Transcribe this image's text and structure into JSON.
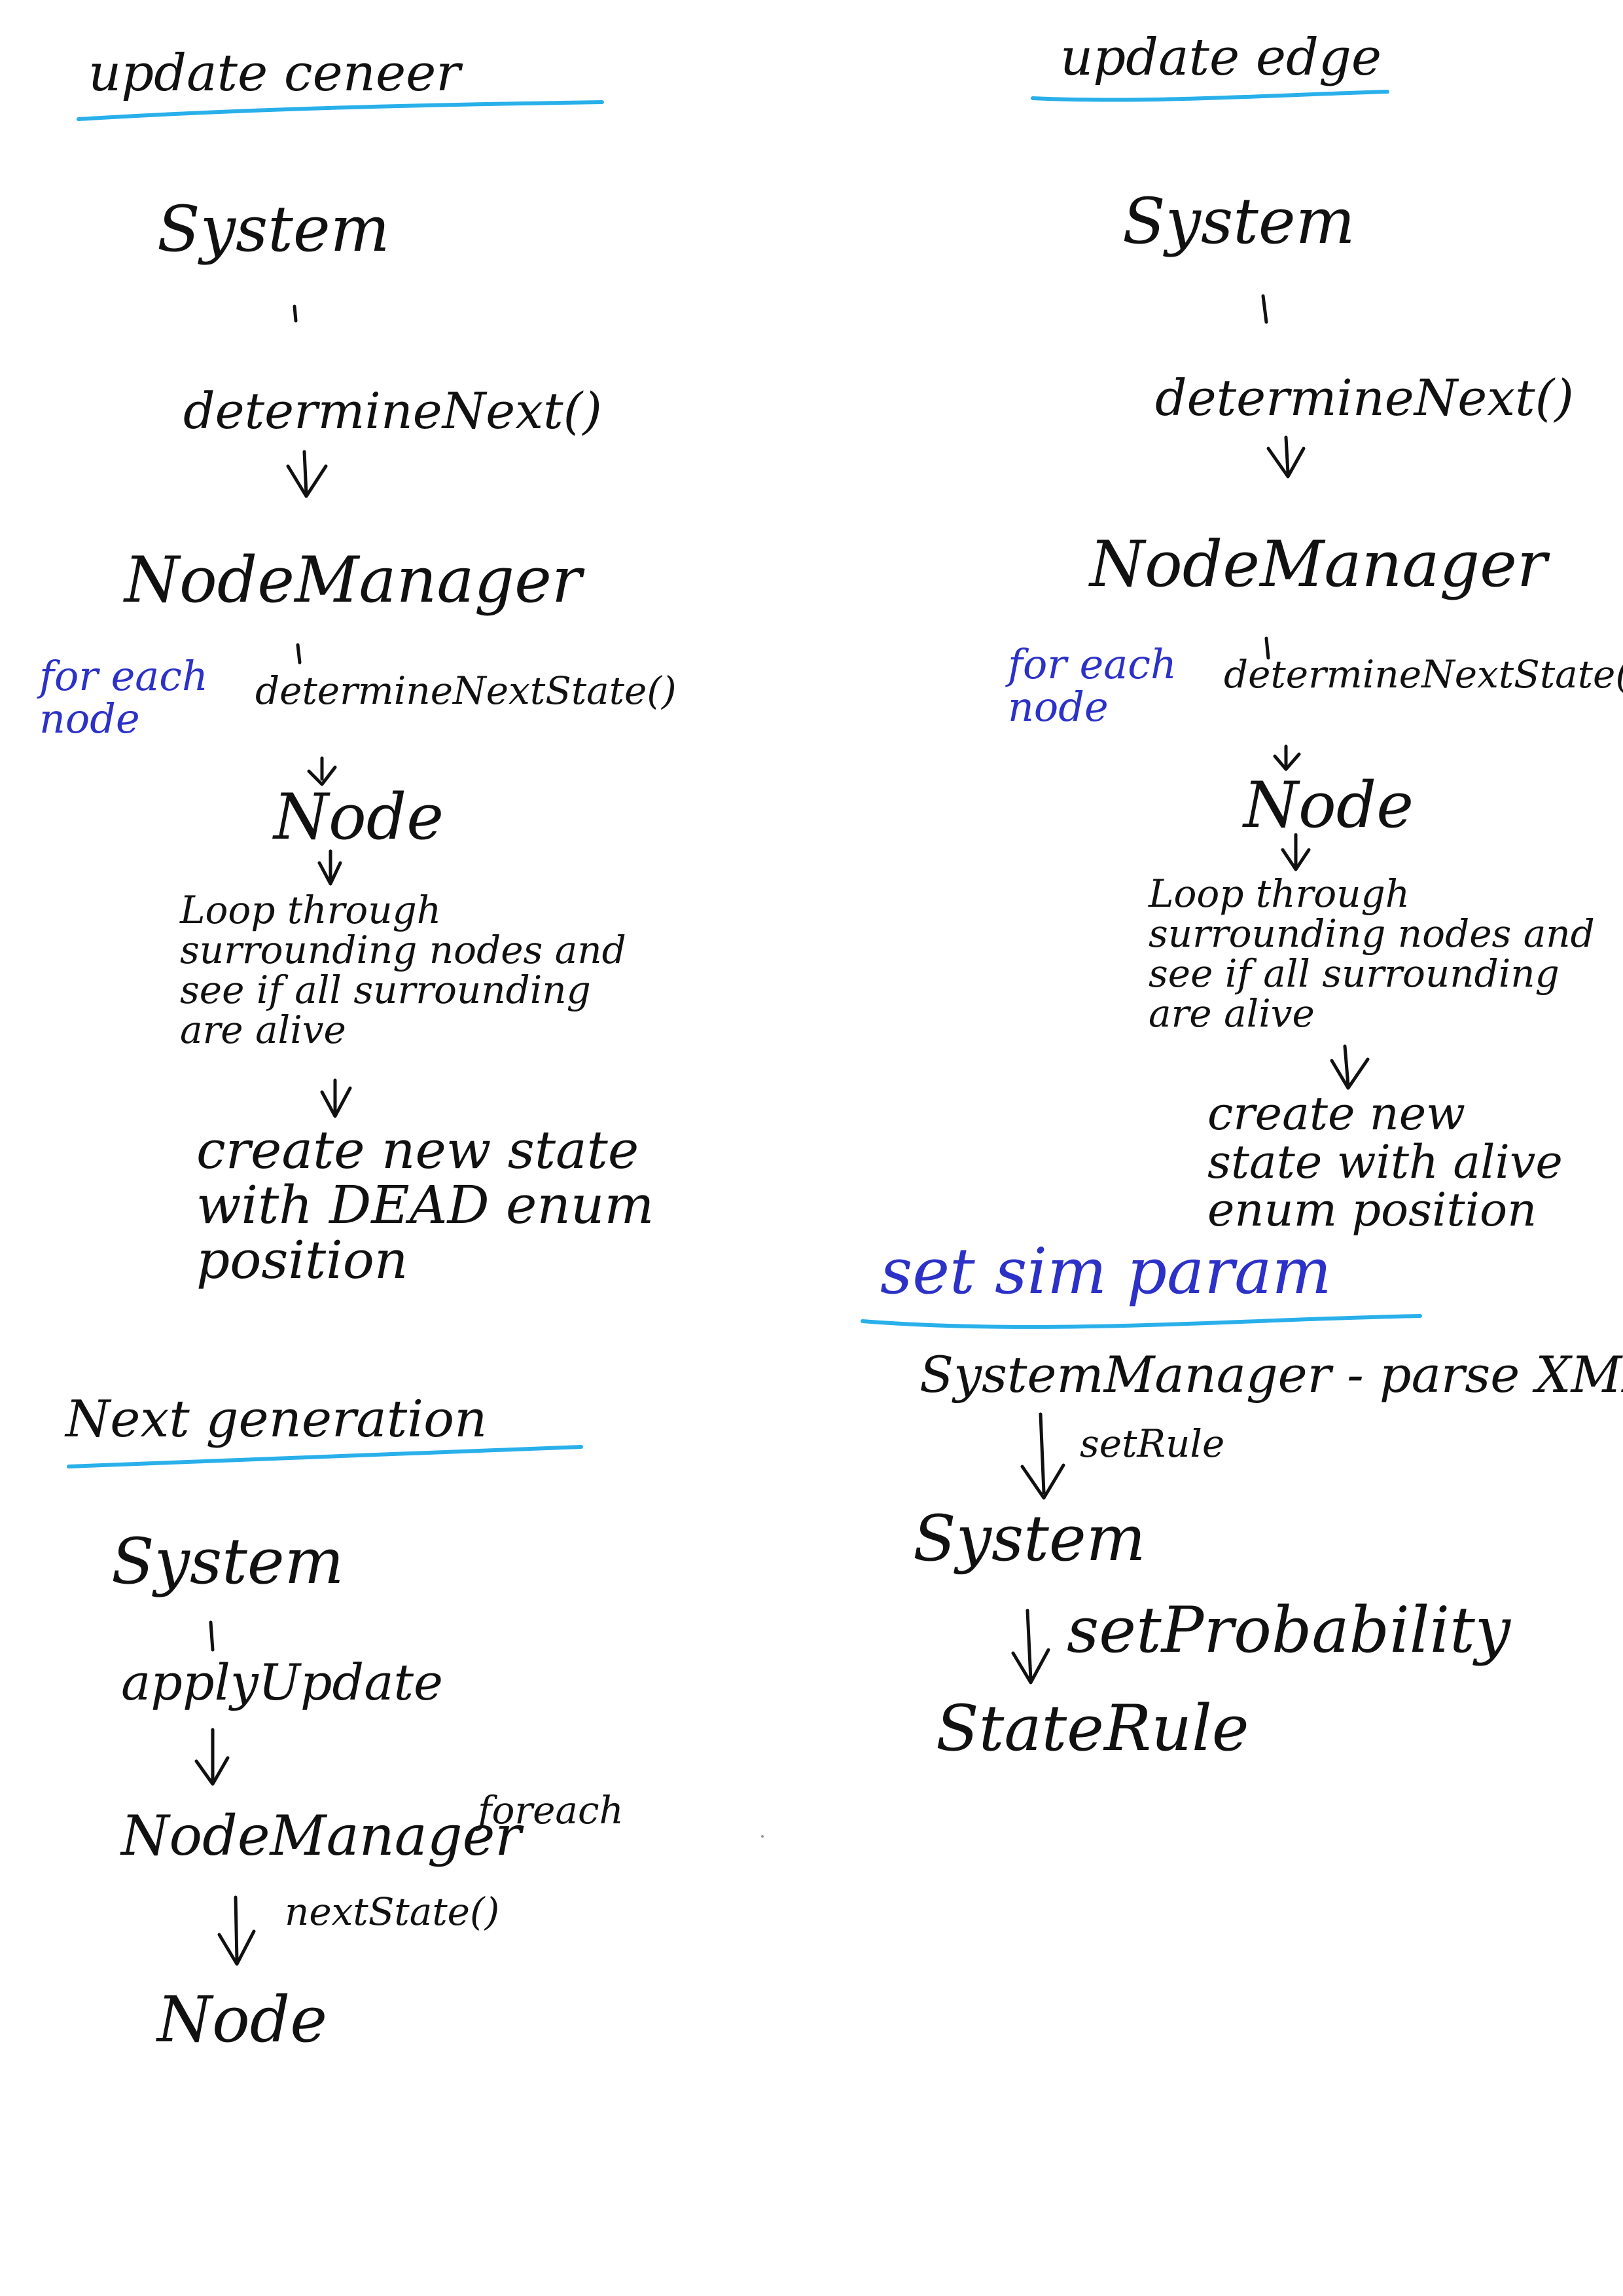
{
  "colors": {
    "ink": "#111111",
    "annotation": "#2c31c7",
    "underline": "#29b0ea"
  },
  "update_center": {
    "title": "update ceneer",
    "system": "System",
    "method_1": "determineNext()",
    "node_manager": "NodeManager",
    "loop_note": "for each node",
    "method_2": "determineNextState()",
    "node": "Node",
    "step_1": "Loop through surrounding nodes and see if all surrounding are alive",
    "step_2": "create new state with DEAD enum position"
  },
  "update_edge": {
    "title": "update edge",
    "system": "System",
    "method_1": "determineNext()",
    "node_manager": "NodeManager",
    "loop_note": "for each node",
    "method_2": "determineNextState()",
    "node": "Node",
    "step_1": "Loop through surrounding nodes and see if all surrounding are alive",
    "step_2": "create new state with alive enum position"
  },
  "next_generation": {
    "title": "Next generation",
    "system": "System",
    "method_1": "applyUpdate",
    "node_manager": "NodeManager",
    "loop_note": "foreach",
    "method_2": "nextState()",
    "node": "Node"
  },
  "set_sim_param": {
    "title": "set sim param",
    "system_manager": "SystemManager - parse XML",
    "method_1": "setRule",
    "system": "System",
    "method_2": "setProbability",
    "state_rule": "StateRule"
  }
}
